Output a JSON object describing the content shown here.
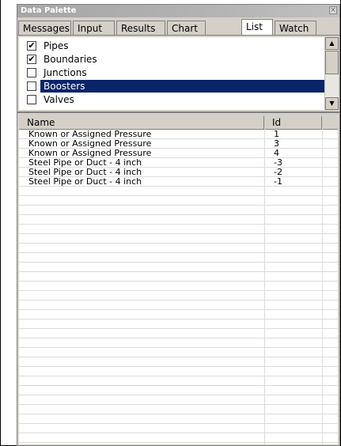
{
  "window": {
    "title": "Data Palette"
  },
  "tabs": [
    {
      "label": "Messages",
      "active": false
    },
    {
      "label": "Input",
      "active": false
    },
    {
      "label": "Results",
      "active": false
    },
    {
      "label": "Chart",
      "active": false
    },
    {
      "label": "List",
      "active": true
    },
    {
      "label": "Watch",
      "active": false
    }
  ],
  "checklist": {
    "items": [
      {
        "label": "Pipes",
        "checked": true,
        "selected": false
      },
      {
        "label": "Boundaries",
        "checked": true,
        "selected": false
      },
      {
        "label": "Junctions",
        "checked": false,
        "selected": false
      },
      {
        "label": "Boosters",
        "checked": false,
        "selected": true
      },
      {
        "label": "Valves",
        "checked": false,
        "selected": false
      }
    ]
  },
  "table": {
    "columns": [
      "Name",
      "Id"
    ],
    "rows": [
      {
        "name": "Known or Assigned Pressure",
        "id": "1"
      },
      {
        "name": "Known or Assigned Pressure",
        "id": "3"
      },
      {
        "name": "Known or Assigned Pressure",
        "id": "4"
      },
      {
        "name": "Steel Pipe or Duct - 4 inch",
        "id": "-3"
      },
      {
        "name": "Steel Pipe or Duct - 4 inch",
        "id": "-2"
      },
      {
        "name": "Steel Pipe or Duct - 4 inch",
        "id": "-1"
      }
    ]
  },
  "icons": {
    "close": "close-icon",
    "scroll_up": "arrow-up-icon",
    "scroll_down": "arrow-down-icon",
    "check": "checkmark-icon"
  }
}
